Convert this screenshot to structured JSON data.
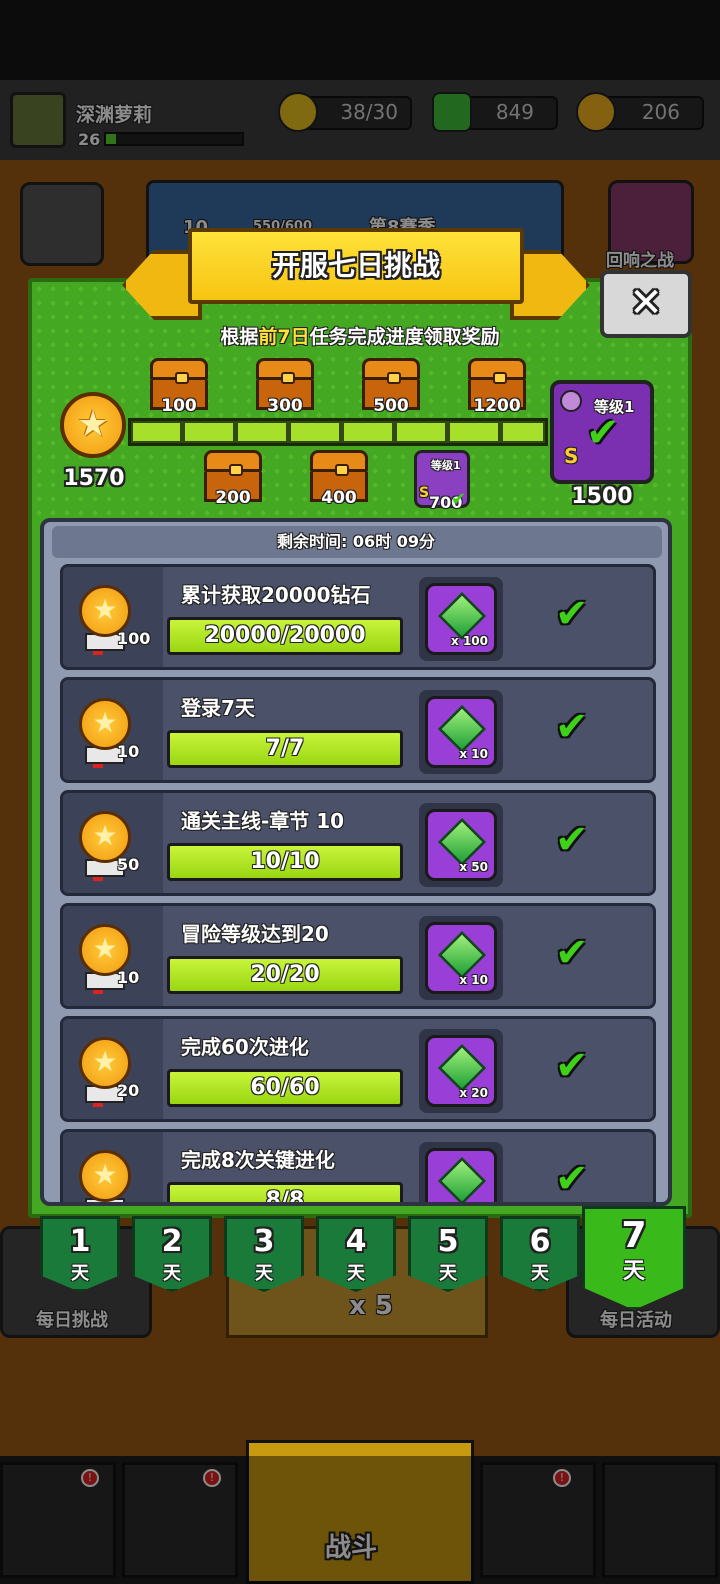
{
  "player": {
    "name": "深渊萝莉",
    "level": "26"
  },
  "currencies": {
    "energy": "38/30",
    "gems": "849",
    "coins": "206"
  },
  "background": {
    "season": "第8赛季",
    "level_badge": "10",
    "xp": "550/600",
    "echo_battle": "回响之战",
    "daily_challenge": "每日挑战",
    "daily_activity": "每日活动",
    "energy_cost": "x 5"
  },
  "modal": {
    "title": "开服七日挑战",
    "subtitle_pre": "根据",
    "subtitle_highlight": "前7日",
    "subtitle_post": "任务完成进度领取奖励",
    "close_icon": "close-icon",
    "total_points": "1570",
    "top_chests": [
      "100",
      "300",
      "500",
      "1200"
    ],
    "bottom_chests": [
      "200",
      "400",
      "700"
    ],
    "reward_level_label": "等级1",
    "grade": "S",
    "big_reward_points": "1500",
    "timer": "剩余时间: 06时 09分",
    "progress_fraction": 1.0
  },
  "tasks": [
    {
      "name": "累计获取20000钻石",
      "points": "100",
      "progress": "20000/20000",
      "reward_qty": "x 100"
    },
    {
      "name": "登录7天",
      "points": "10",
      "progress": "7/7",
      "reward_qty": "x 10"
    },
    {
      "name": "通关主线-章节 10",
      "points": "50",
      "progress": "10/10",
      "reward_qty": "x 50"
    },
    {
      "name": "冒险等级达到20",
      "points": "10",
      "progress": "20/20",
      "reward_qty": "x 10"
    },
    {
      "name": "完成60次进化",
      "points": "20",
      "progress": "60/60",
      "reward_qty": "x 20"
    },
    {
      "name": "完成8次关键进化",
      "points": "",
      "progress": "8/8",
      "reward_qty": ""
    }
  ],
  "days": [
    {
      "n": "1",
      "t": "天"
    },
    {
      "n": "2",
      "t": "天"
    },
    {
      "n": "3",
      "t": "天"
    },
    {
      "n": "4",
      "t": "天"
    },
    {
      "n": "5",
      "t": "天"
    },
    {
      "n": "6",
      "t": "天"
    },
    {
      "n": "7",
      "t": "天"
    }
  ],
  "nav": {
    "battle": "战斗",
    "badge": "!"
  }
}
